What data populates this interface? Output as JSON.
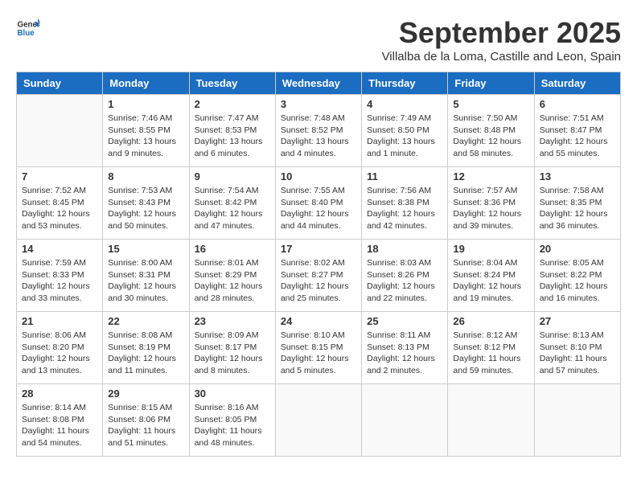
{
  "logo": {
    "general": "General",
    "blue": "Blue"
  },
  "title": "September 2025",
  "location": "Villalba de la Loma, Castille and Leon, Spain",
  "headers": [
    "Sunday",
    "Monday",
    "Tuesday",
    "Wednesday",
    "Thursday",
    "Friday",
    "Saturday"
  ],
  "weeks": [
    [
      {
        "day": "",
        "info": ""
      },
      {
        "day": "1",
        "info": "Sunrise: 7:46 AM\nSunset: 8:55 PM\nDaylight: 13 hours\nand 9 minutes."
      },
      {
        "day": "2",
        "info": "Sunrise: 7:47 AM\nSunset: 8:53 PM\nDaylight: 13 hours\nand 6 minutes."
      },
      {
        "day": "3",
        "info": "Sunrise: 7:48 AM\nSunset: 8:52 PM\nDaylight: 13 hours\nand 4 minutes."
      },
      {
        "day": "4",
        "info": "Sunrise: 7:49 AM\nSunset: 8:50 PM\nDaylight: 13 hours\nand 1 minute."
      },
      {
        "day": "5",
        "info": "Sunrise: 7:50 AM\nSunset: 8:48 PM\nDaylight: 12 hours\nand 58 minutes."
      },
      {
        "day": "6",
        "info": "Sunrise: 7:51 AM\nSunset: 8:47 PM\nDaylight: 12 hours\nand 55 minutes."
      }
    ],
    [
      {
        "day": "7",
        "info": "Sunrise: 7:52 AM\nSunset: 8:45 PM\nDaylight: 12 hours\nand 53 minutes."
      },
      {
        "day": "8",
        "info": "Sunrise: 7:53 AM\nSunset: 8:43 PM\nDaylight: 12 hours\nand 50 minutes."
      },
      {
        "day": "9",
        "info": "Sunrise: 7:54 AM\nSunset: 8:42 PM\nDaylight: 12 hours\nand 47 minutes."
      },
      {
        "day": "10",
        "info": "Sunrise: 7:55 AM\nSunset: 8:40 PM\nDaylight: 12 hours\nand 44 minutes."
      },
      {
        "day": "11",
        "info": "Sunrise: 7:56 AM\nSunset: 8:38 PM\nDaylight: 12 hours\nand 42 minutes."
      },
      {
        "day": "12",
        "info": "Sunrise: 7:57 AM\nSunset: 8:36 PM\nDaylight: 12 hours\nand 39 minutes."
      },
      {
        "day": "13",
        "info": "Sunrise: 7:58 AM\nSunset: 8:35 PM\nDaylight: 12 hours\nand 36 minutes."
      }
    ],
    [
      {
        "day": "14",
        "info": "Sunrise: 7:59 AM\nSunset: 8:33 PM\nDaylight: 12 hours\nand 33 minutes."
      },
      {
        "day": "15",
        "info": "Sunrise: 8:00 AM\nSunset: 8:31 PM\nDaylight: 12 hours\nand 30 minutes."
      },
      {
        "day": "16",
        "info": "Sunrise: 8:01 AM\nSunset: 8:29 PM\nDaylight: 12 hours\nand 28 minutes."
      },
      {
        "day": "17",
        "info": "Sunrise: 8:02 AM\nSunset: 8:27 PM\nDaylight: 12 hours\nand 25 minutes."
      },
      {
        "day": "18",
        "info": "Sunrise: 8:03 AM\nSunset: 8:26 PM\nDaylight: 12 hours\nand 22 minutes."
      },
      {
        "day": "19",
        "info": "Sunrise: 8:04 AM\nSunset: 8:24 PM\nDaylight: 12 hours\nand 19 minutes."
      },
      {
        "day": "20",
        "info": "Sunrise: 8:05 AM\nSunset: 8:22 PM\nDaylight: 12 hours\nand 16 minutes."
      }
    ],
    [
      {
        "day": "21",
        "info": "Sunrise: 8:06 AM\nSunset: 8:20 PM\nDaylight: 12 hours\nand 13 minutes."
      },
      {
        "day": "22",
        "info": "Sunrise: 8:08 AM\nSunset: 8:19 PM\nDaylight: 12 hours\nand 11 minutes."
      },
      {
        "day": "23",
        "info": "Sunrise: 8:09 AM\nSunset: 8:17 PM\nDaylight: 12 hours\nand 8 minutes."
      },
      {
        "day": "24",
        "info": "Sunrise: 8:10 AM\nSunset: 8:15 PM\nDaylight: 12 hours\nand 5 minutes."
      },
      {
        "day": "25",
        "info": "Sunrise: 8:11 AM\nSunset: 8:13 PM\nDaylight: 12 hours\nand 2 minutes."
      },
      {
        "day": "26",
        "info": "Sunrise: 8:12 AM\nSunset: 8:12 PM\nDaylight: 11 hours\nand 59 minutes."
      },
      {
        "day": "27",
        "info": "Sunrise: 8:13 AM\nSunset: 8:10 PM\nDaylight: 11 hours\nand 57 minutes."
      }
    ],
    [
      {
        "day": "28",
        "info": "Sunrise: 8:14 AM\nSunset: 8:08 PM\nDaylight: 11 hours\nand 54 minutes."
      },
      {
        "day": "29",
        "info": "Sunrise: 8:15 AM\nSunset: 8:06 PM\nDaylight: 11 hours\nand 51 minutes."
      },
      {
        "day": "30",
        "info": "Sunrise: 8:16 AM\nSunset: 8:05 PM\nDaylight: 11 hours\nand 48 minutes."
      },
      {
        "day": "",
        "info": ""
      },
      {
        "day": "",
        "info": ""
      },
      {
        "day": "",
        "info": ""
      },
      {
        "day": "",
        "info": ""
      }
    ]
  ]
}
